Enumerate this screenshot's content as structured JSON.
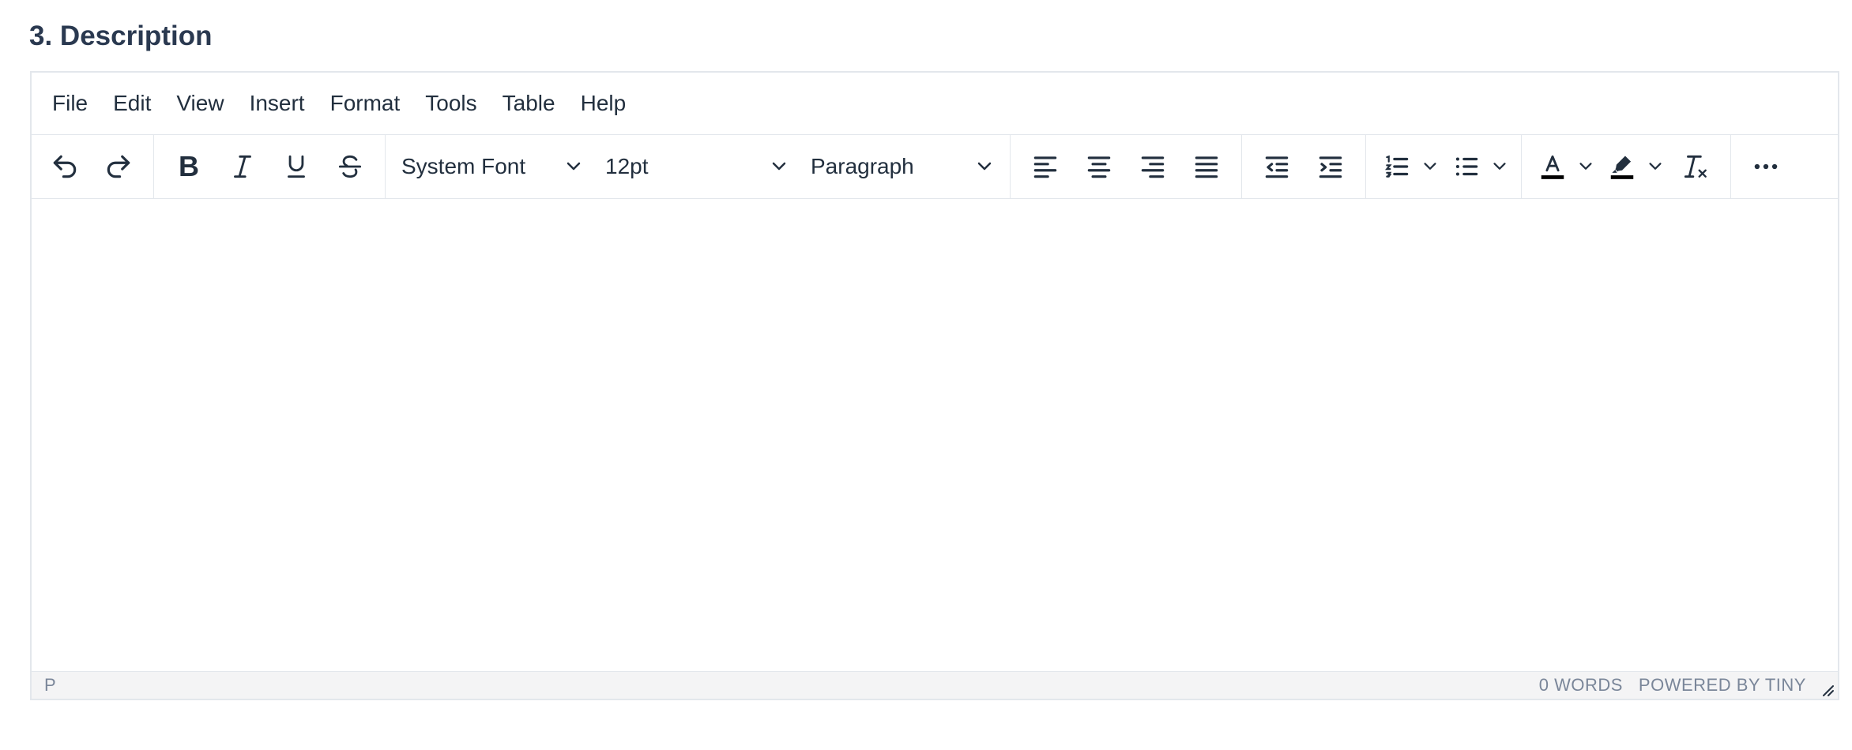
{
  "section": {
    "title": "3. Description"
  },
  "menubar": [
    "File",
    "Edit",
    "View",
    "Insert",
    "Format",
    "Tools",
    "Table",
    "Help"
  ],
  "toolbar": {
    "bold_label": "B",
    "font_family": "System Font",
    "font_size": "12pt",
    "block_format": "Paragraph",
    "icons": [
      "undo-icon",
      "redo-icon",
      "bold-icon",
      "italic-icon",
      "underline-icon",
      "strikethrough-icon",
      "align-left-icon",
      "align-center-icon",
      "align-right-icon",
      "align-justify-icon",
      "outdent-icon",
      "indent-icon",
      "numbered-list-icon",
      "bullet-list-icon",
      "text-color-icon",
      "highlight-color-icon",
      "clear-formatting-icon",
      "more-icon"
    ],
    "text_color": "#000000",
    "highlight_color": "#000000"
  },
  "statusbar": {
    "path": "P",
    "word_count": "0 WORDS",
    "branding": "POWERED BY TINY"
  },
  "colors": {
    "text": "#222f3e",
    "border": "#e3e7ec",
    "status_bg": "#f4f4f5",
    "status_text": "#7a8699"
  }
}
